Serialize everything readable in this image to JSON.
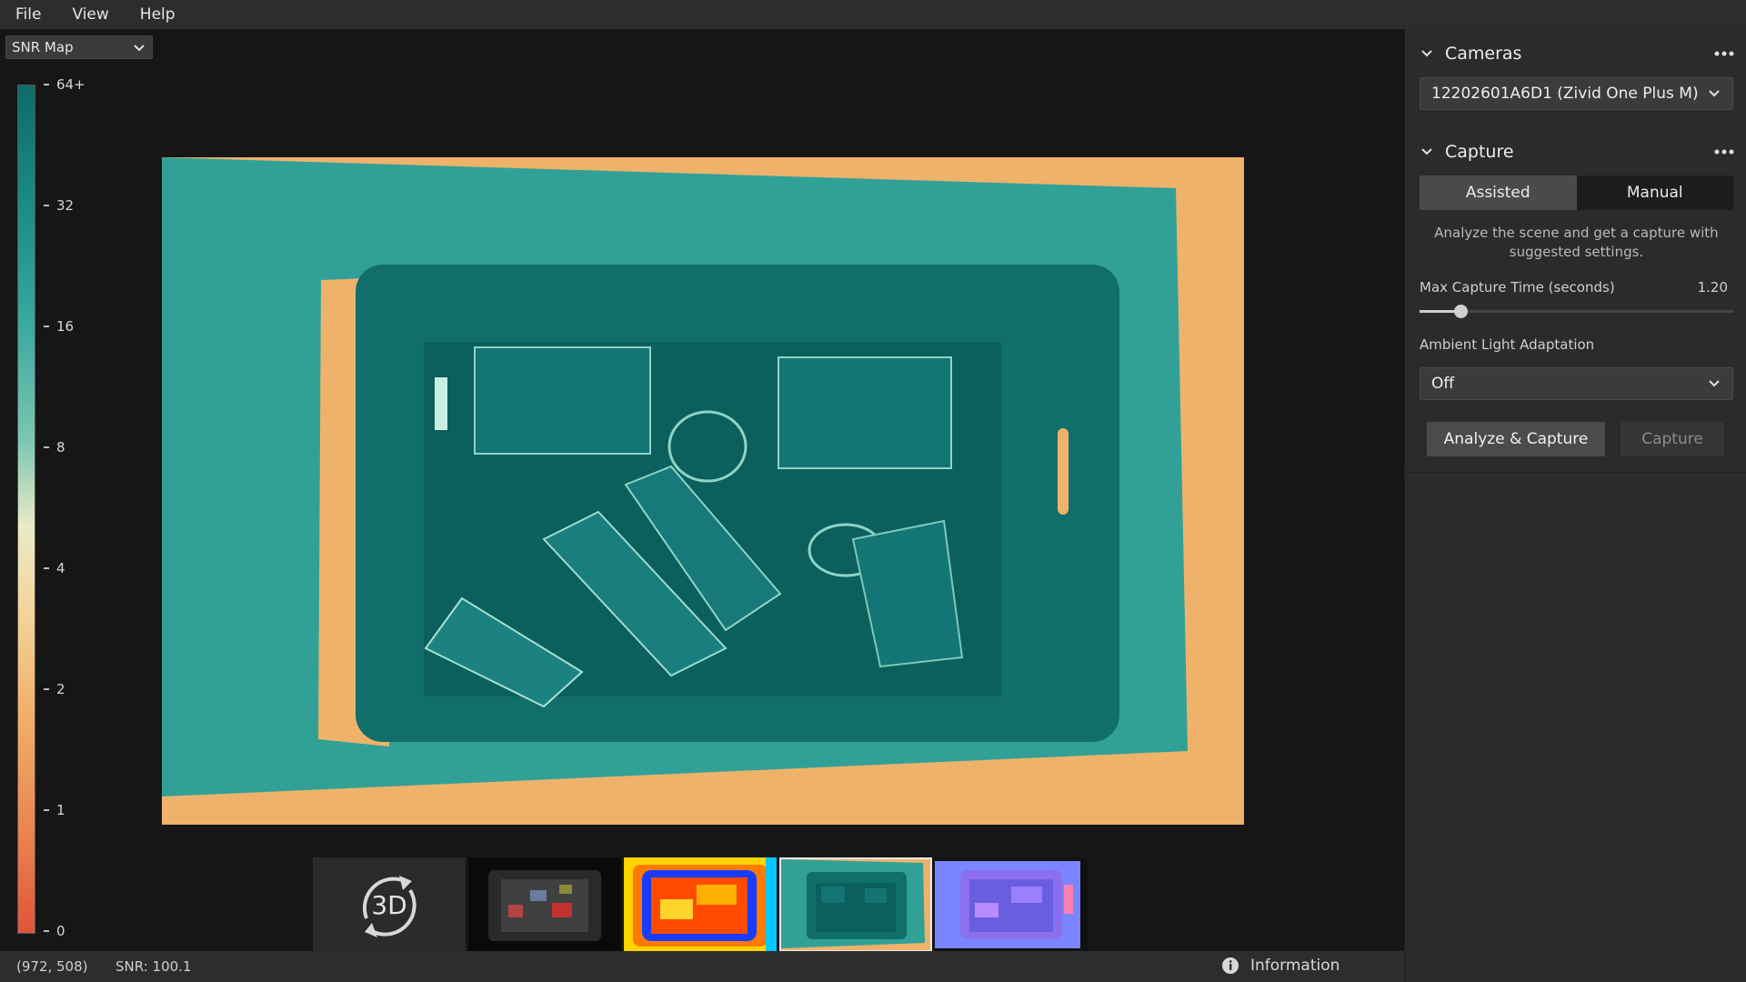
{
  "menubar": {
    "items": [
      "File",
      "View",
      "Help"
    ]
  },
  "viewer": {
    "view_mode": "SNR Map",
    "colorbar_ticks": [
      "64+",
      "32",
      "16",
      "8",
      "4",
      "2",
      "1",
      "0"
    ],
    "thumbnails": [
      {
        "name": "3D",
        "label": "3D"
      },
      {
        "name": "Color"
      },
      {
        "name": "Depth"
      },
      {
        "name": "SNR"
      },
      {
        "name": "Normals"
      }
    ],
    "selected_thumbnail": "SNR"
  },
  "panel": {
    "cameras": {
      "title": "Cameras",
      "selected_camera": "12202601A6D1 (Zivid One Plus M)"
    },
    "capture": {
      "title": "Capture",
      "tabs": [
        "Assisted",
        "Manual"
      ],
      "active_tab": "Assisted",
      "hint": "Analyze the scene and get a capture with suggested settings.",
      "max_capture_time_label": "Max Capture Time (seconds)",
      "max_capture_time_value": "1.20",
      "max_capture_time_fraction": 0.13,
      "ambient_label": "Ambient Light Adaptation",
      "ambient_value": "Off",
      "analyze_button": "Analyze & Capture",
      "capture_button": "Capture"
    }
  },
  "statusbar": {
    "coords": "(972, 508)",
    "snr": "SNR: 100.1",
    "info": "Information"
  },
  "colors": {
    "accent_teal": "#2a9a8e",
    "dark_teal": "#0d6b6b",
    "orange": "#efb26b"
  }
}
